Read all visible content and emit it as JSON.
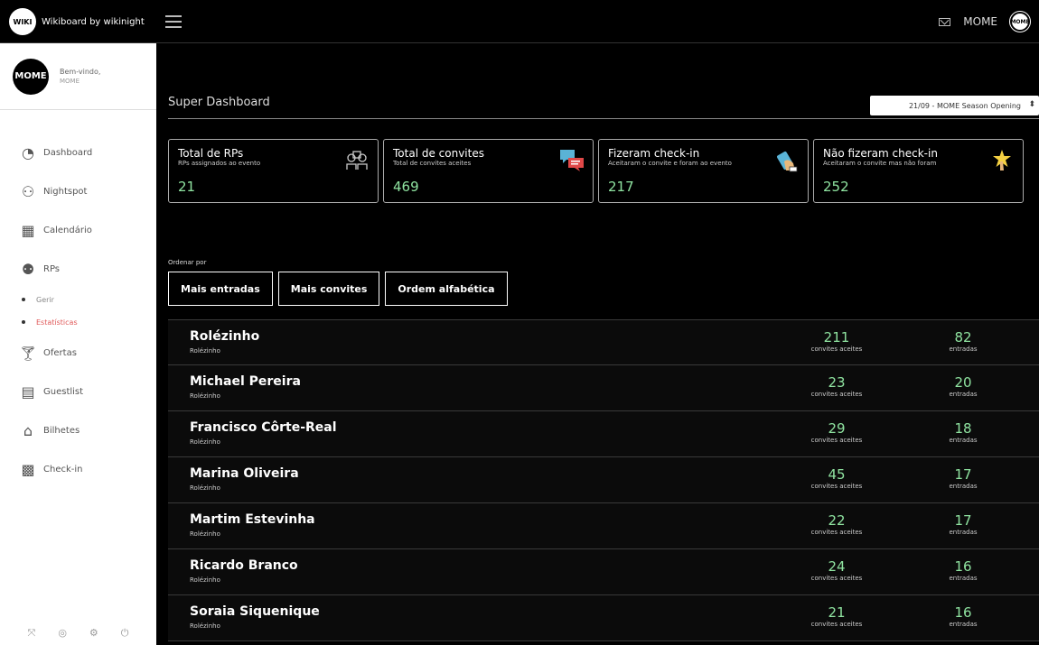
{
  "topbar": {
    "brand_logo": "WIKI",
    "brand_name": "Wikiboard by wikinight",
    "username": "MOME",
    "avatar_text": "MOME"
  },
  "sidebar": {
    "avatar_text": "MOME",
    "welcome": "Bem-vindo,",
    "username": "MOME",
    "items": [
      {
        "label": "Dashboard",
        "icon": "gauge-icon"
      },
      {
        "label": "Nightspot",
        "icon": "spot-icon"
      },
      {
        "label": "Calendário",
        "icon": "calendar-icon"
      },
      {
        "label": "RPs",
        "icon": "users-icon"
      },
      {
        "label": "Ofertas",
        "icon": "cocktail-icon"
      },
      {
        "label": "Guestlist",
        "icon": "clipboard-icon"
      },
      {
        "label": "Bilhetes",
        "icon": "ticket-icon"
      },
      {
        "label": "Check-in",
        "icon": "qr-icon"
      }
    ],
    "rps_sub": [
      {
        "label": "Gerir"
      },
      {
        "label": "Estatísticas"
      }
    ]
  },
  "main": {
    "title": "Super Dashboard",
    "event": "21/09 - MOME Season Opening",
    "cards": [
      {
        "title": "Total de RPs",
        "sub": "RPs assignados ao evento",
        "value": "21",
        "icon": "people-icon"
      },
      {
        "title": "Total de convites",
        "sub": "Total de convites aceites",
        "value": "469",
        "icon": "chat-icon"
      },
      {
        "title": "Fizeram check-in",
        "sub": "Aceitaram o convite e foram ao evento",
        "value": "217",
        "icon": "phone-scan-icon"
      },
      {
        "title": "Não fizeram check-in",
        "sub": "Aceitaram o convite mas não foram",
        "value": "252",
        "icon": "star-hand-icon"
      }
    ],
    "sort_label": "Ordenar por",
    "sort_buttons": [
      "Mais entradas",
      "Mais convites",
      "Ordem alfabética"
    ],
    "rows": [
      {
        "name": "Rolézinho",
        "sub": "Rolézinho",
        "invites": "211",
        "entries": "82"
      },
      {
        "name": "Michael Pereira",
        "sub": "Rolézinho",
        "invites": "23",
        "entries": "20"
      },
      {
        "name": "Francisco Côrte-Real",
        "sub": "Rolézinho",
        "invites": "29",
        "entries": "18"
      },
      {
        "name": "Marina Oliveira",
        "sub": "Rolézinho",
        "invites": "45",
        "entries": "17"
      },
      {
        "name": "Martim Estevinha",
        "sub": "Rolézinho",
        "invites": "22",
        "entries": "17"
      },
      {
        "name": "Ricardo Branco",
        "sub": "Rolézinho",
        "invites": "24",
        "entries": "16"
      },
      {
        "name": "Soraia Siquenique",
        "sub": "Rolézinho",
        "invites": "21",
        "entries": "16"
      }
    ],
    "invites_label": "convites aceites",
    "entries_label": "entradas"
  }
}
